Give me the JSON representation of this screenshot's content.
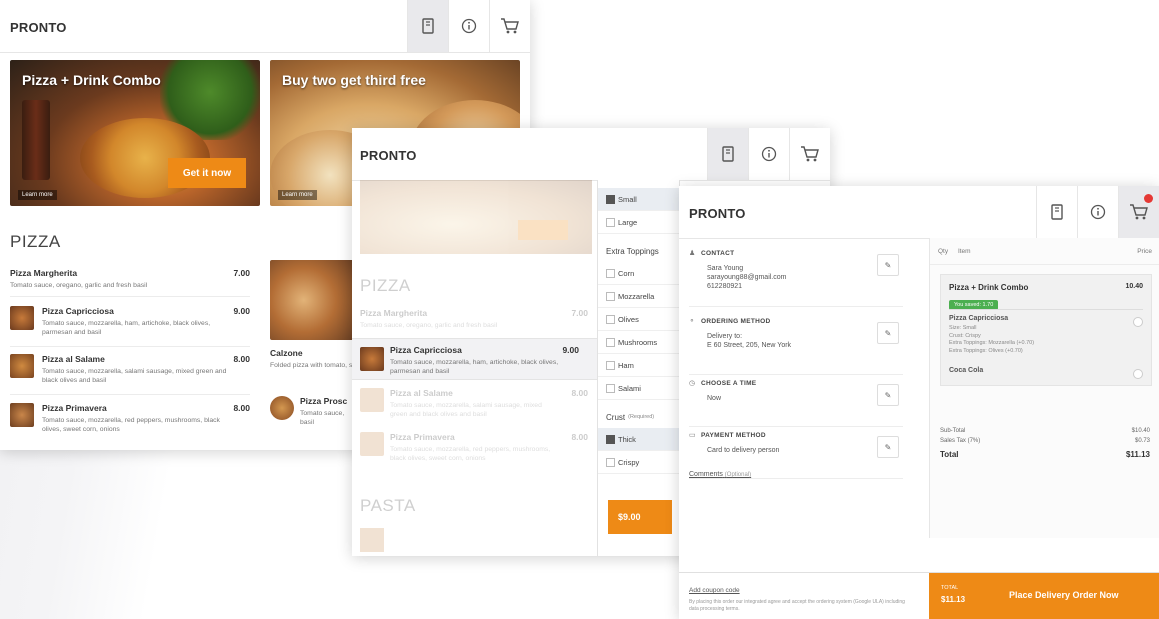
{
  "brand": "PRONTO",
  "colors": {
    "accent": "#ee8a16",
    "saved_green": "#4caf50",
    "badge_red": "#e53935"
  },
  "icons": [
    "menu-book-icon",
    "info-icon",
    "cart-icon"
  ],
  "menu_screen": {
    "promos": [
      {
        "title": "Pizza + Drink Combo",
        "cta": "Get it now",
        "learn": "Learn more"
      },
      {
        "title": "Buy two get third free",
        "learn": "Learn more"
      }
    ],
    "pizza_section": "PIZZA",
    "items": [
      {
        "name": "Pizza Margherita",
        "desc": "Tomato sauce, oregano, garlic and fresh basil",
        "price": "7.00"
      },
      {
        "name": "Pizza Capricciosa",
        "desc": "Tomato sauce, mozzarella, ham, artichoke, black olives, parmesan and basil",
        "price": "9.00"
      },
      {
        "name": "Pizza al Salame",
        "desc": "Tomato sauce, mozzarella, salami sausage, mixed green and black olives and basil",
        "price": "8.00"
      },
      {
        "name": "Pizza Primavera",
        "desc": "Tomato sauce, mozzarella, red peppers, mushrooms, black olives, sweet corn, onions",
        "price": "8.00"
      }
    ],
    "right_items": [
      {
        "name": "Calzone",
        "desc": "Folded pizza with tomato, salami, extra virgin olive"
      },
      {
        "name": "Pizza Prosc",
        "desc": "Tomato sauce, basil"
      }
    ]
  },
  "options_screen": {
    "pasta_section": "PASTA",
    "size_options": [
      {
        "label": "Small",
        "selected": true
      },
      {
        "label": "Large",
        "selected": false
      }
    ],
    "extra_toppings_label": "Extra Toppings",
    "toppings": [
      "Corn",
      "Mozzarella",
      "Olives",
      "Mushrooms",
      "Ham",
      "Salami"
    ],
    "crust_label": "Crust",
    "crust_required": "(Required)",
    "crust_options": [
      {
        "label": "Thick",
        "selected": true
      },
      {
        "label": "Crispy",
        "selected": false
      }
    ],
    "price_button": "$9.00"
  },
  "checkout_screen": {
    "contact": {
      "title": "CONTACT",
      "lines": [
        "Sara Young",
        "sarayoung88@gmail.com",
        "612280921"
      ]
    },
    "ordering_method": {
      "title": "ORDERING METHOD",
      "lines": [
        "Delivery to:",
        "E 60 Street, 205, New York"
      ]
    },
    "time": {
      "title": "CHOOSE A TIME",
      "lines": [
        "Now"
      ]
    },
    "payment": {
      "title": "PAYMENT METHOD",
      "lines": [
        "Card to delivery person"
      ]
    },
    "comments_label": "Comments",
    "comments_optional": "(Optional)",
    "cart": {
      "qty_header": "Qty",
      "item_header": "Item",
      "price_header": "Price",
      "combo_name": "Pizza + Drink Combo",
      "combo_price": "10.40",
      "saved_badge": "You saved: 1.70",
      "sub_item_1": "Pizza Capricciosa",
      "sub_item_1_details": [
        "Size: Small",
        "Crust: Crispy",
        "Extra Toppings: Mozzarella (+0.70)",
        "Extra Toppings: Olives (+0.70)"
      ],
      "sub_item_2": "Coca Cola",
      "subtotal_label": "Sub-Total",
      "subtotal_value": "$10.40",
      "tax_label": "Sales Tax (7%)",
      "tax_value": "$0.73",
      "total_label": "Total",
      "total_value": "$11.13"
    },
    "coupon": "Add coupon code",
    "terms": "By placing this order our integrated agree and accept the ordering system (Google ULA) including data processing terms.",
    "order_total_label": "TOTAL",
    "order_total_value": "$11.13",
    "order_button": "Place Delivery Order Now"
  }
}
